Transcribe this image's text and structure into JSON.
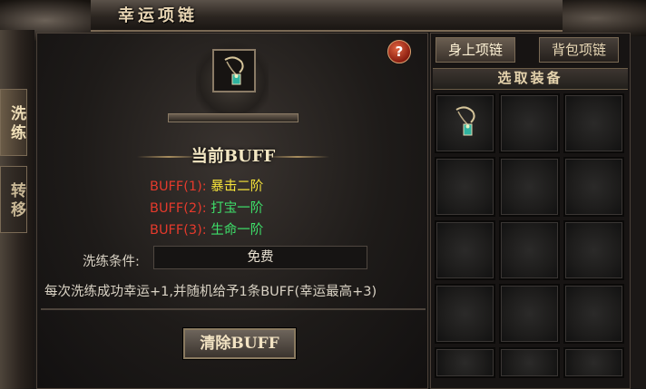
{
  "window": {
    "title": "幸运项链"
  },
  "sidebar": {
    "tabs": [
      {
        "label": "洗练",
        "active": true
      },
      {
        "label": "转移",
        "active": false
      }
    ]
  },
  "left": {
    "help_label": "?",
    "buff_title": "当前BUFF",
    "buffs": [
      {
        "label": "BUFF(1):",
        "value": "暴击二阶",
        "color": "#f4e23a"
      },
      {
        "label": "BUFF(2):",
        "value": "打宝一阶",
        "color": "#3ee06a"
      },
      {
        "label": "BUFF(3):",
        "value": "生命一阶",
        "color": "#3ee06a"
      }
    ],
    "condition_label": "洗练条件:",
    "condition_value": "免费",
    "description": "每次洗练成功幸运+1,并随机给予1条BUFF(幸运最高+3)",
    "clear_button": "清除BUFF"
  },
  "right": {
    "tabs": [
      {
        "label": "身上项链",
        "active": true
      },
      {
        "label": "背包项链",
        "active": false
      }
    ],
    "section_title": "选取装备",
    "slots": [
      {
        "item": "necklace-icon"
      },
      {},
      {},
      {},
      {},
      {},
      {},
      {},
      {},
      {},
      {},
      {},
      {},
      {},
      {}
    ]
  }
}
